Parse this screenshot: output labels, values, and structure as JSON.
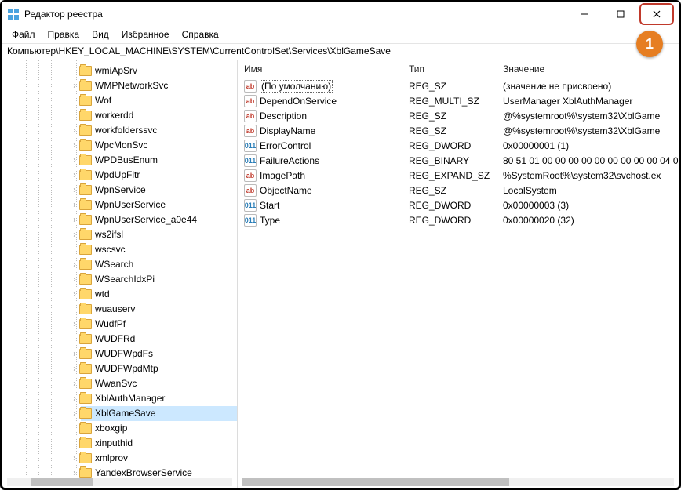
{
  "window": {
    "title": "Редактор реестра"
  },
  "callout": "1",
  "menu": {
    "file": "Файл",
    "edit": "Правка",
    "view": "Вид",
    "favorites": "Избранное",
    "help": "Справка"
  },
  "address": "Компьютер\\HKEY_LOCAL_MACHINE\\SYSTEM\\CurrentControlSet\\Services\\XblGameSave",
  "tree": [
    {
      "label": "wmiApSrv",
      "exp": false
    },
    {
      "label": "WMPNetworkSvc",
      "exp": true
    },
    {
      "label": "Wof",
      "exp": false
    },
    {
      "label": "workerdd",
      "exp": false
    },
    {
      "label": "workfolderssvc",
      "exp": true
    },
    {
      "label": "WpcMonSvc",
      "exp": true
    },
    {
      "label": "WPDBusEnum",
      "exp": true
    },
    {
      "label": "WpdUpFltr",
      "exp": true
    },
    {
      "label": "WpnService",
      "exp": true
    },
    {
      "label": "WpnUserService",
      "exp": true
    },
    {
      "label": "WpnUserService_a0e44",
      "exp": true
    },
    {
      "label": "ws2ifsl",
      "exp": true
    },
    {
      "label": "wscsvc",
      "exp": false
    },
    {
      "label": "WSearch",
      "exp": true
    },
    {
      "label": "WSearchIdxPi",
      "exp": true
    },
    {
      "label": "wtd",
      "exp": true
    },
    {
      "label": "wuauserv",
      "exp": false
    },
    {
      "label": "WudfPf",
      "exp": true
    },
    {
      "label": "WUDFRd",
      "exp": false
    },
    {
      "label": "WUDFWpdFs",
      "exp": true
    },
    {
      "label": "WUDFWpdMtp",
      "exp": true
    },
    {
      "label": "WwanSvc",
      "exp": true
    },
    {
      "label": "XblAuthManager",
      "exp": true
    },
    {
      "label": "XblGameSave",
      "exp": true,
      "selected": true
    },
    {
      "label": "xboxgip",
      "exp": false
    },
    {
      "label": "xinputhid",
      "exp": false
    },
    {
      "label": "xmlprov",
      "exp": true
    },
    {
      "label": "YandexBrowserService",
      "exp": true
    }
  ],
  "columns": {
    "name": "Имя",
    "type": "Тип",
    "value": "Значение"
  },
  "rows": [
    {
      "icon": "str",
      "name": "(По умолчанию)",
      "type": "REG_SZ",
      "value": "(значение не присвоено)",
      "default": true
    },
    {
      "icon": "str",
      "name": "DependOnService",
      "type": "REG_MULTI_SZ",
      "value": "UserManager XblAuthManager"
    },
    {
      "icon": "str",
      "name": "Description",
      "type": "REG_SZ",
      "value": "@%systemroot%\\system32\\XblGame"
    },
    {
      "icon": "str",
      "name": "DisplayName",
      "type": "REG_SZ",
      "value": "@%systemroot%\\system32\\XblGame"
    },
    {
      "icon": "bin",
      "name": "ErrorControl",
      "type": "REG_DWORD",
      "value": "0x00000001 (1)"
    },
    {
      "icon": "bin",
      "name": "FailureActions",
      "type": "REG_BINARY",
      "value": "80 51 01 00 00 00 00 00 00 00 00 00 04 0"
    },
    {
      "icon": "str",
      "name": "ImagePath",
      "type": "REG_EXPAND_SZ",
      "value": "%SystemRoot%\\system32\\svchost.ex"
    },
    {
      "icon": "str",
      "name": "ObjectName",
      "type": "REG_SZ",
      "value": "LocalSystem"
    },
    {
      "icon": "bin",
      "name": "Start",
      "type": "REG_DWORD",
      "value": "0x00000003 (3)"
    },
    {
      "icon": "bin",
      "name": "Type",
      "type": "REG_DWORD",
      "value": "0x00000020 (32)"
    }
  ]
}
